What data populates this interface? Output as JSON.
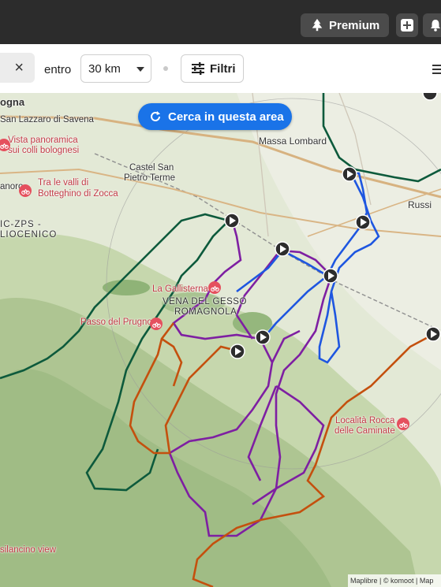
{
  "header": {
    "premium_label": "Premium",
    "icons": [
      "tree-icon",
      "plus-icon",
      "bell-icon"
    ]
  },
  "filterbar": {
    "clear_symbol": "×",
    "within_label": "entro",
    "distance_value": "30 km",
    "filters_label": "Filtri"
  },
  "map": {
    "search_area_label": "Cerca in questa area",
    "attribution": "Maplibre | © komoot | Map",
    "places": [
      {
        "text": "ogna"
      },
      {
        "text": "San Lazzaro di Savena"
      },
      {
        "text": "Vista panoramica"
      },
      {
        "text": "sui colli bolognesi"
      },
      {
        "text": "Massa Lombard"
      },
      {
        "text": "Castel San"
      },
      {
        "text": "Pietro Terme"
      },
      {
        "text": "Tra le valli di"
      },
      {
        "text": "Botteghino di Zocca"
      },
      {
        "text": "anoro"
      },
      {
        "text": "Russi"
      },
      {
        "text": "IC-ZPS -"
      },
      {
        "text": "LIOCENICO"
      },
      {
        "text": "La Gallisterna"
      },
      {
        "text": "VENA DEL GESSO"
      },
      {
        "text": "ROMAGNOLA"
      },
      {
        "text": "Passo del Prugno"
      },
      {
        "text": "Località Rocca"
      },
      {
        "text": "delle Caminate"
      },
      {
        "text": "silancino view"
      }
    ],
    "colors": {
      "purple": "#7e1fa2",
      "orange": "#c4500e",
      "green": "#0d5a3c",
      "blue": "#1e56e0",
      "accent": "#1a73e8"
    }
  }
}
